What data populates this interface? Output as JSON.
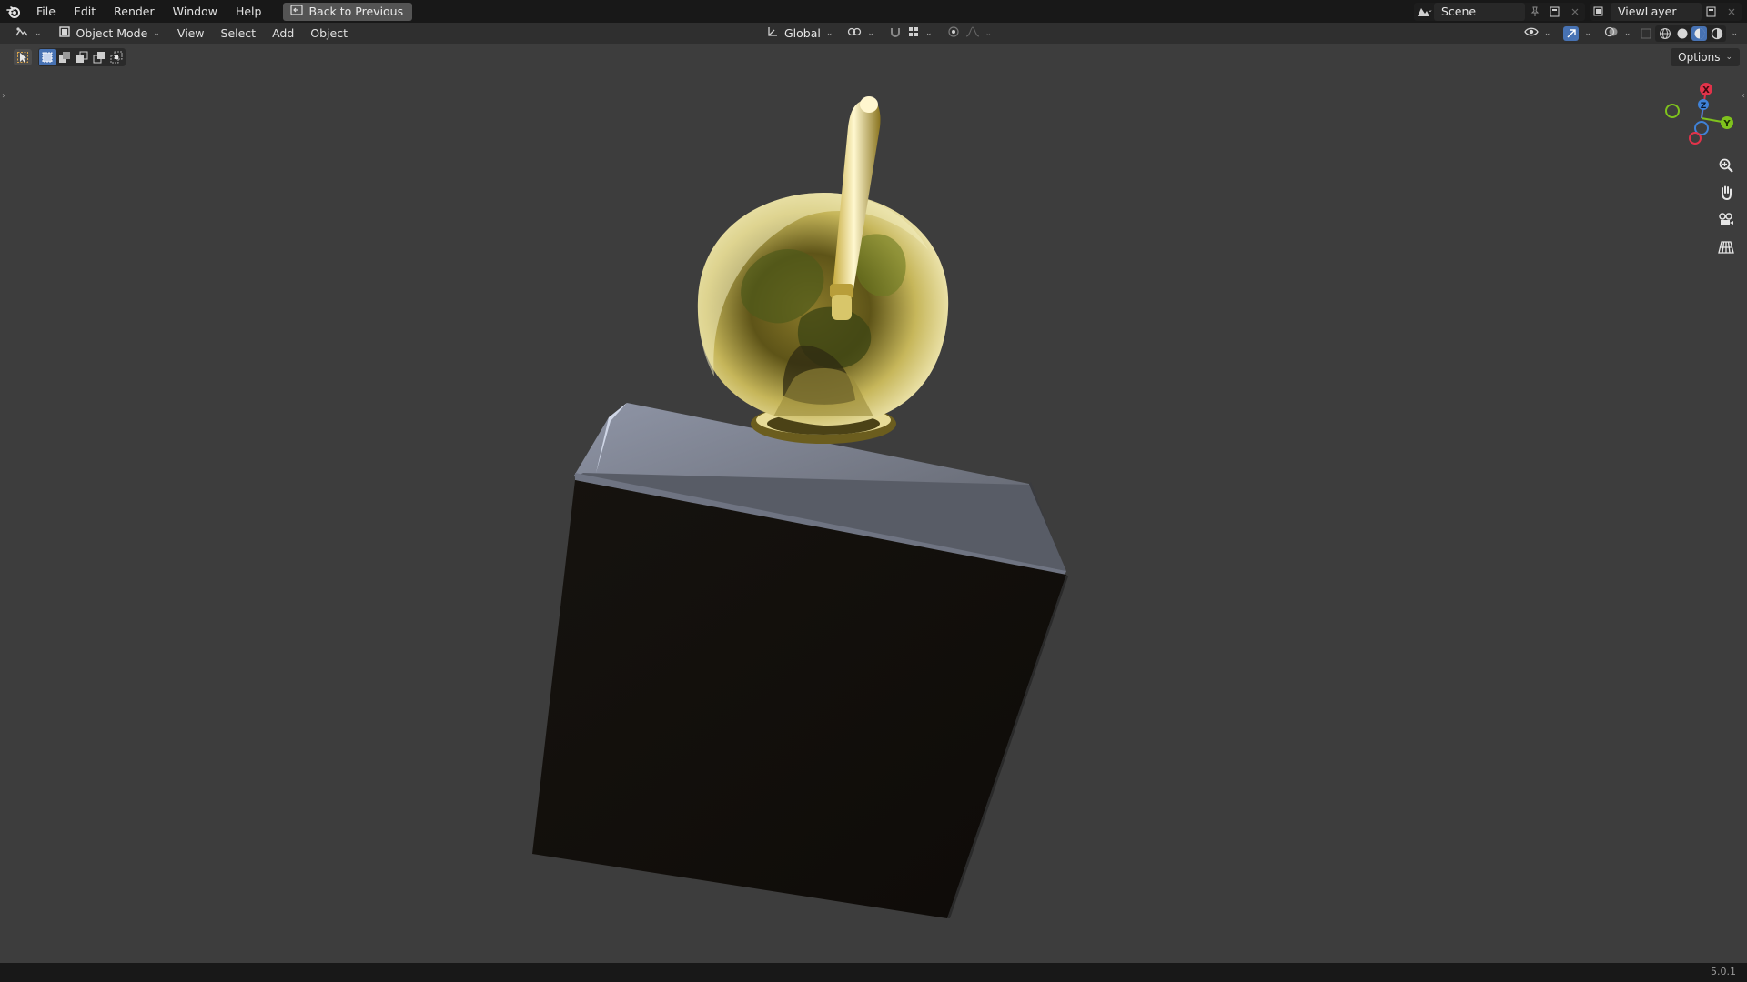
{
  "topbar": {
    "menus": [
      "File",
      "Edit",
      "Render",
      "Window",
      "Help"
    ],
    "back_label": "Back to Previous",
    "scene_name": "Scene",
    "view_layer": "ViewLayer"
  },
  "viewport_header": {
    "mode": "Object Mode",
    "menus": [
      "View",
      "Select",
      "Add",
      "Object"
    ],
    "transform_orientation": "Global"
  },
  "toolbar": {
    "options_label": "Options"
  },
  "gizmo": {
    "x_label": "X",
    "y_label": "Y",
    "z_label": "Z",
    "colors": {
      "x": "#e2334a",
      "y": "#7fc21d",
      "z": "#3f82d8"
    }
  },
  "status": {
    "version": "5.0.1"
  }
}
